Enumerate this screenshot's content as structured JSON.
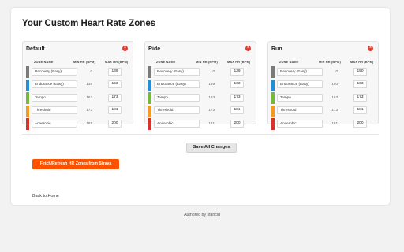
{
  "page_title": "Your Custom Heart Rate Zones",
  "colors": {
    "accent": "#fc5200",
    "remove_button": "#e23b2e",
    "zones": [
      "#7a7a7a",
      "#1f8fd8",
      "#76b83c",
      "#f29a22",
      "#d8322a"
    ]
  },
  "column_headers": {
    "name": "ZONE NAME",
    "min": "MIN HR (BPM)",
    "max": "MAX HR (BPM)"
  },
  "panels": [
    {
      "title": "Default",
      "remove_icon": "close-icon",
      "zones": [
        {
          "name": "Recovery (Easy)",
          "min": "0",
          "max": "139"
        },
        {
          "name": "Endurance (Easy)",
          "min": "139",
          "max": "163"
        },
        {
          "name": "Tempo",
          "min": "163",
          "max": "173"
        },
        {
          "name": "Threshold",
          "min": "173",
          "max": "181"
        },
        {
          "name": "Anaerobic",
          "min": "181",
          "max": "200"
        }
      ]
    },
    {
      "title": "Ride",
      "remove_icon": "close-icon",
      "zones": [
        {
          "name": "Recovery (Easy)",
          "min": "0",
          "max": "139"
        },
        {
          "name": "Endurance (Easy)",
          "min": "139",
          "max": "163"
        },
        {
          "name": "Tempo",
          "min": "163",
          "max": "173"
        },
        {
          "name": "Threshold",
          "min": "173",
          "max": "181"
        },
        {
          "name": "Anaerobic",
          "min": "181",
          "max": "200"
        }
      ]
    },
    {
      "title": "Run",
      "remove_icon": "close-icon",
      "zones": [
        {
          "name": "Recovery (Easy)",
          "min": "0",
          "max": "150"
        },
        {
          "name": "Endurance (Easy)",
          "min": "150",
          "max": "163"
        },
        {
          "name": "Tempo",
          "min": "163",
          "max": "173"
        },
        {
          "name": "Threshold",
          "min": "173",
          "max": "181"
        },
        {
          "name": "Anaerobic",
          "min": "181",
          "max": "200"
        }
      ]
    }
  ],
  "save_label": "Save All Changes",
  "fetch_label": "Fetch/Refresh HR Zones from Strava",
  "back_label": "Back to Home",
  "footer_text": "Authored by stancid"
}
